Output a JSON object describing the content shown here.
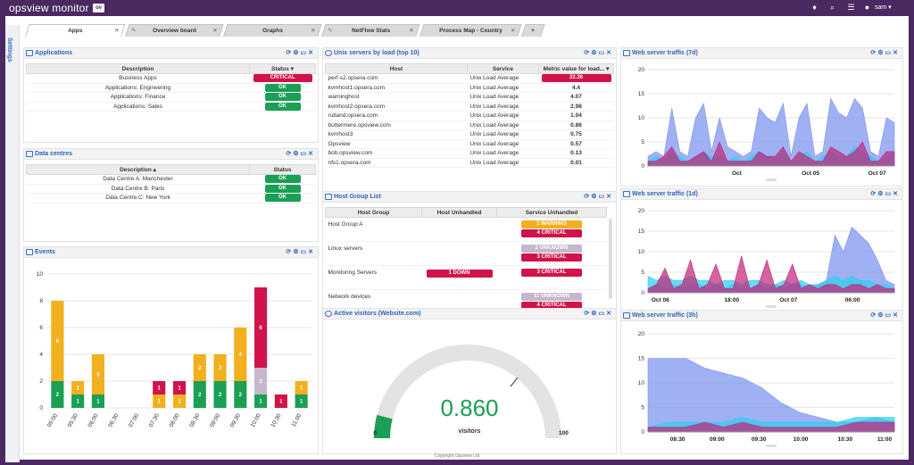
{
  "app": {
    "brand": "opsview monitor",
    "user": "sam",
    "footer": "Copyright Opsview Ltd"
  },
  "settings_label": "Settings",
  "tabs": [
    {
      "label": "Apps",
      "active": true
    },
    {
      "label": "Overview board"
    },
    {
      "label": "Graphs"
    },
    {
      "label": "NetFlow Stats"
    },
    {
      "label": "Process Map - Country"
    },
    {
      "label": "+"
    }
  ],
  "panel_icons": [
    "refresh-icon",
    "gear-icon",
    "maximize-icon",
    "close-icon"
  ],
  "applications": {
    "title": "Applications",
    "col_desc": "Description",
    "col_status": "Status",
    "rows": [
      {
        "desc": "Business Apps",
        "status": "CRITICAL"
      },
      {
        "desc": "Applications: Engineering",
        "status": "OK"
      },
      {
        "desc": "Applications: Finance",
        "status": "OK"
      },
      {
        "desc": "Applications: Sales",
        "status": "OK"
      }
    ]
  },
  "datacentres": {
    "title": "Data centres",
    "col_desc": "Description",
    "col_status": "Status",
    "rows": [
      {
        "desc": "Data Centre A: Manchester",
        "status": "OK"
      },
      {
        "desc": "Data Centre B: Paris",
        "status": "OK"
      },
      {
        "desc": "Data Centre C: New York",
        "status": "OK"
      }
    ]
  },
  "unix": {
    "title": "Unix servers by load (top 10)",
    "col_host": "Host",
    "col_service": "Service",
    "col_metric": "Metric value for load...",
    "rows": [
      {
        "host": "perf-s2.opsera.com",
        "service": "Unix Load Average",
        "value": "32.36",
        "critical": true
      },
      {
        "host": "kvmhost1.opsera.com",
        "service": "Unix Load Average",
        "value": "4.4"
      },
      {
        "host": "warninghost",
        "service": "Unix Load Average",
        "value": "4.07"
      },
      {
        "host": "kvmhost2.opsera.com",
        "service": "Unix Load Average",
        "value": "2.98"
      },
      {
        "host": "rutland.opsera.com",
        "service": "Unix Load Average",
        "value": "1.04"
      },
      {
        "host": "buttermere.opsview.com",
        "service": "Unix Load Average",
        "value": "0.86"
      },
      {
        "host": "kvmhost3",
        "service": "Unix Load Average",
        "value": "0.75"
      },
      {
        "host": "Opsview",
        "service": "Unix Load Average",
        "value": "0.57"
      },
      {
        "host": "bob.opsview.com",
        "service": "Unix Load Average",
        "value": "0.13"
      },
      {
        "host": "nfs1.opsera.com",
        "service": "Unix Load Average",
        "value": "0.01"
      }
    ]
  },
  "hostgroups": {
    "title": "Host Group List",
    "col_group": "Host Group",
    "col_host": "Host Unhandled",
    "col_service": "Service Unhandled",
    "rows": [
      {
        "group": "Host Group A",
        "host": "",
        "service": [
          {
            "label": "1 WARNING",
            "kind": "warn"
          },
          {
            "label": "4 CRITICAL",
            "kind": "crit"
          }
        ]
      },
      {
        "group": "Linux servers",
        "host": "",
        "service": [
          {
            "label": "2 UNKNOWN",
            "kind": "unk"
          },
          {
            "label": "3 CRITICAL",
            "kind": "crit"
          }
        ]
      },
      {
        "group": "Monitoring Servers",
        "host": "1 DOWN",
        "service": [
          {
            "label": "3 CRITICAL",
            "kind": "crit"
          }
        ]
      },
      {
        "group": "Network devices",
        "host": "",
        "service": [
          {
            "label": "11 UNKNOWN",
            "kind": "unk"
          },
          {
            "label": "4 CRITICAL",
            "kind": "crit"
          }
        ]
      }
    ]
  },
  "events": {
    "title": "Events"
  },
  "visitors": {
    "title": "Active visitors (Website.com)",
    "value": "0.860",
    "label": "visitors",
    "min": "0",
    "max": "100",
    "level": 0.0086
  },
  "traffic7d": {
    "title": "Web server traffic (7d)"
  },
  "traffic1d": {
    "title": "Web server traffic (1d)"
  },
  "traffic3h": {
    "title": "Web server traffic (3h)"
  },
  "chart_data": [
    {
      "type": "bar",
      "stacked": true,
      "categories": [
        "05:00",
        "05:30",
        "06:00",
        "06:30",
        "07:00",
        "07:30",
        "08:00",
        "08:30",
        "09:00",
        "09:30",
        "10:00",
        "10:30",
        "11:00"
      ],
      "series": [
        {
          "values": [
            2,
            1,
            1,
            0,
            0,
            0,
            0,
            2,
            2,
            2,
            1,
            0,
            1
          ],
          "color": "#1a9f55"
        },
        {
          "values": [
            6,
            1,
            3,
            0,
            0,
            1,
            1,
            2,
            2,
            4,
            0,
            0,
            1
          ],
          "color": "#f2b01e"
        },
        {
          "values": [
            0,
            0,
            0,
            0,
            0,
            0,
            0,
            0,
            0,
            0,
            2,
            0,
            0
          ],
          "color": "#c6b8cc"
        },
        {
          "values": [
            0,
            0,
            0,
            0,
            0,
            1,
            1,
            0,
            0,
            0,
            6,
            1,
            0
          ],
          "color": "#d0134a"
        }
      ],
      "ylim": [
        0,
        10
      ],
      "yticks": [
        0,
        2,
        4,
        6,
        8,
        10
      ],
      "grid": true
    },
    {
      "type": "area",
      "xlabels": [
        "Oct",
        "Oct 05",
        "Oct 07"
      ],
      "ylim": [
        0,
        20
      ],
      "yticks": [
        0,
        5,
        10,
        15,
        20
      ],
      "series": [
        {
          "color": "#7b93ef",
          "values": [
            2,
            3,
            2,
            12,
            3,
            2,
            10,
            13,
            3,
            10,
            4,
            3,
            2,
            3,
            12,
            10,
            9,
            13,
            2,
            10,
            13,
            2,
            3,
            14,
            11,
            10,
            14,
            12,
            3,
            2,
            10,
            9
          ]
        },
        {
          "color": "#2ad0ee",
          "values": [
            1,
            2,
            1,
            3,
            2,
            1,
            2,
            3,
            2,
            2,
            1,
            2,
            1,
            2,
            3,
            2,
            2,
            3,
            1,
            2,
            3,
            1,
            2,
            3,
            2,
            2,
            4,
            3,
            2,
            1,
            2,
            3
          ]
        },
        {
          "color": "#c2287a",
          "values": [
            1,
            1,
            2,
            4,
            1,
            1,
            2,
            3,
            1,
            5,
            1,
            1,
            1,
            1,
            3,
            2,
            2,
            4,
            1,
            3,
            2,
            1,
            1,
            4,
            3,
            2,
            3,
            5,
            1,
            1,
            3,
            3
          ]
        }
      ]
    },
    {
      "type": "area",
      "xlabels": [
        "Oct 06",
        "18:00",
        "Oct 07",
        "06:00"
      ],
      "ylim": [
        0,
        20
      ],
      "yticks": [
        0,
        5,
        10,
        15,
        20
      ],
      "series": [
        {
          "color": "#7b93ef",
          "values": [
            1,
            2,
            1,
            2,
            1,
            2,
            2,
            1,
            2,
            1,
            2,
            1,
            1,
            2,
            1,
            2,
            1,
            2,
            2,
            1,
            2,
            3,
            14,
            10,
            16,
            14,
            12,
            8,
            3,
            2
          ]
        },
        {
          "color": "#2ad0ee",
          "values": [
            4,
            3,
            4,
            3,
            3,
            4,
            3,
            3,
            2,
            3,
            3,
            2,
            3,
            3,
            2,
            2,
            3,
            2,
            3,
            2,
            2,
            3,
            4,
            3,
            4,
            3,
            3,
            2,
            2,
            1
          ]
        },
        {
          "color": "#c2287a",
          "values": [
            1,
            2,
            6,
            1,
            2,
            8,
            1,
            2,
            7,
            1,
            1,
            9,
            1,
            2,
            8,
            1,
            2,
            7,
            1,
            2,
            1,
            2,
            2,
            1,
            2,
            2,
            1,
            2,
            1,
            1
          ]
        }
      ]
    },
    {
      "type": "area",
      "xlabels": [
        "08:30",
        "09:00",
        "09:30",
        "10:00",
        "10:30",
        "11:00"
      ],
      "ylim": [
        0,
        20
      ],
      "yticks": [
        0,
        5,
        10,
        15,
        20
      ],
      "series": [
        {
          "color": "#7b93ef",
          "values": [
            15,
            15,
            15,
            13,
            12,
            11,
            9,
            6,
            4,
            3,
            2,
            2,
            3,
            2
          ]
        },
        {
          "color": "#2ad0ee",
          "values": [
            1,
            2,
            2,
            2,
            2,
            3,
            2,
            2,
            2,
            2,
            2,
            3,
            3,
            3
          ]
        },
        {
          "color": "#c2287a",
          "values": [
            1,
            1,
            1,
            2,
            1,
            2,
            1,
            1,
            1,
            1,
            1,
            2,
            2,
            2
          ]
        }
      ]
    }
  ]
}
